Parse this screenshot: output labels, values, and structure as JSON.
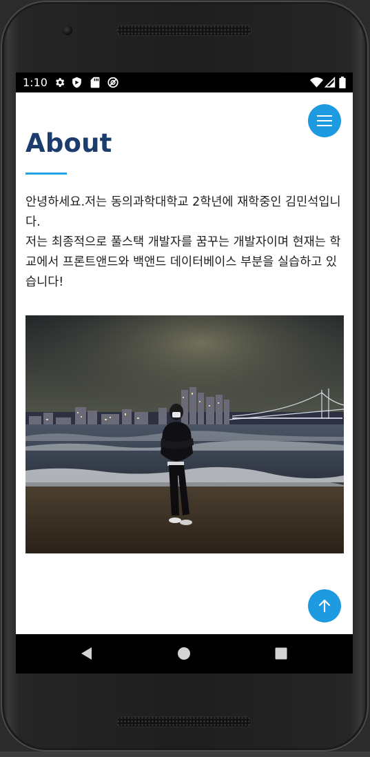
{
  "status_bar": {
    "time": "1:10",
    "left_icons": [
      "gear-icon",
      "shield-icon",
      "sd-card-icon",
      "do-not-disturb-icon"
    ],
    "right_icons": [
      "wifi-icon",
      "signal-icon",
      "battery-icon"
    ]
  },
  "page": {
    "title": "About",
    "intro": [
      "안녕하세요.저는 동의과학대학교 2학년에 재학중인 김민석입니다.",
      "저는 최종적으로 풀스택 개발자를 꿈꾸는 개발자이며 현재는 학교에서 프론트앤드와 백앤드 데이터베이스 부분을 실습하고 있습니다!"
    ],
    "photo_icon": "photo-person-night-beach"
  },
  "buttons": {
    "menu_icon": "hamburger-icon",
    "top_icon": "arrow-up-icon"
  },
  "nav_bar": {
    "back_icon": "back-triangle-icon",
    "home_icon": "home-circle-icon",
    "recents_icon": "recents-square-icon"
  },
  "colors": {
    "accent": "#1e9be0",
    "title": "#1d3c6e",
    "text": "#1e1e1e"
  }
}
